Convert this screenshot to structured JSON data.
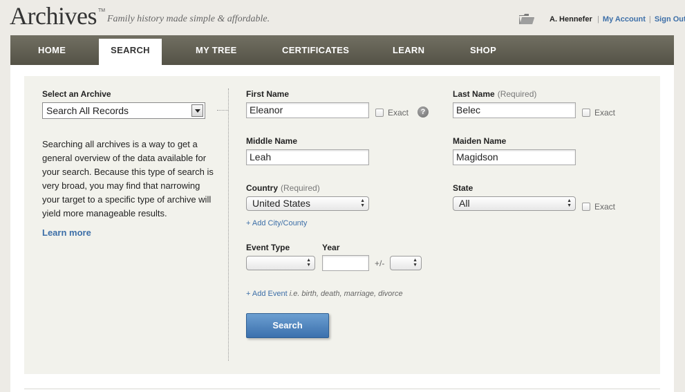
{
  "header": {
    "logo": "Archives",
    "logo_tm": "TM",
    "tagline": "Family history made simple & affordable.",
    "user_name": "A. Hennefer",
    "my_account": "My Account",
    "sign_out": "Sign Out",
    "separator": "|"
  },
  "nav": {
    "items": [
      {
        "label": "HOME"
      },
      {
        "label": "SEARCH",
        "active": true
      },
      {
        "label": "MY TREE"
      },
      {
        "label": "CERTIFICATES"
      },
      {
        "label": "LEARN"
      },
      {
        "label": "SHOP"
      }
    ]
  },
  "left": {
    "archive_label": "Select an Archive",
    "archive_value": "Search All Records",
    "description": "Searching all archives is a way to get a general overview of the data available for your search. Because this type of search is very broad, you may find that narrowing your target to a specific type of archive will yield more manageable results.",
    "learn_more": "Learn more"
  },
  "form": {
    "first_name_label": "First Name",
    "first_name_value": "Eleanor",
    "exact_label": "Exact",
    "help_icon": "?",
    "last_name_label": "Last Name",
    "required_text": "(Required)",
    "last_name_value": "Belec",
    "middle_name_label": "Middle Name",
    "middle_name_value": "Leah",
    "maiden_name_label": "Maiden Name",
    "maiden_name_value": "Magidson",
    "country_label": "Country",
    "country_value": "United States",
    "state_label": "State",
    "state_value": "All",
    "add_city": "+ Add City/County",
    "event_type_label": "Event Type",
    "event_type_value": "",
    "year_label": "Year",
    "year_value": "",
    "plusminus": "+/-",
    "range_value": "",
    "add_event": "+ Add Event",
    "add_event_hint": "i.e. birth, death, marriage, divorce",
    "search_button": "Search"
  },
  "colors": {
    "nav_bg": "#5f5d51",
    "link": "#3d6fa8",
    "panel_bg": "#f2f2ec",
    "button": "#4a80bd"
  }
}
